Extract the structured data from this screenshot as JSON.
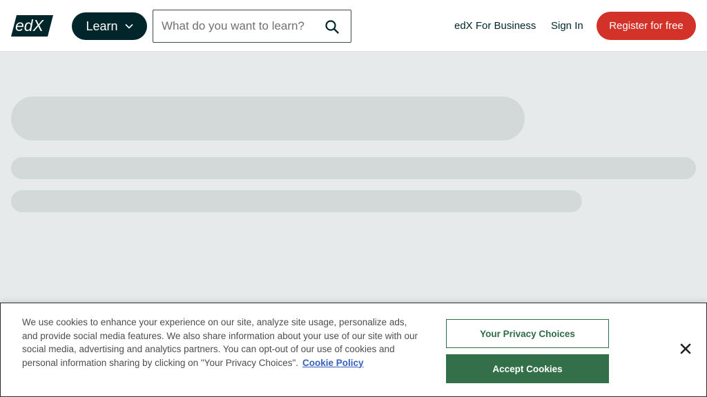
{
  "header": {
    "logo_text": "edX",
    "learn_label": "Learn",
    "search": {
      "placeholder": "What do you want to learn?"
    },
    "for_business_label": "edX For Business",
    "sign_in_label": "Sign In",
    "register_label": "Register for free"
  },
  "cookie_banner": {
    "text": "We use cookies to enhance your experience on our site, analyze site usage, personalize ads, and provide social media features. We also share information about your use of our site with our social media, advertising and analytics partners. You can opt-out of our use of cookies and personal information sharing by clicking on \"Your Privacy Choices\".",
    "policy_link": "Cookie Policy",
    "privacy_choices_label": "Your Privacy Choices",
    "accept_label": "Accept Cookies"
  },
  "colors": {
    "brand_dark": "#00262b",
    "register": "#d23228",
    "accept": "#33704a",
    "link": "#3860be"
  }
}
